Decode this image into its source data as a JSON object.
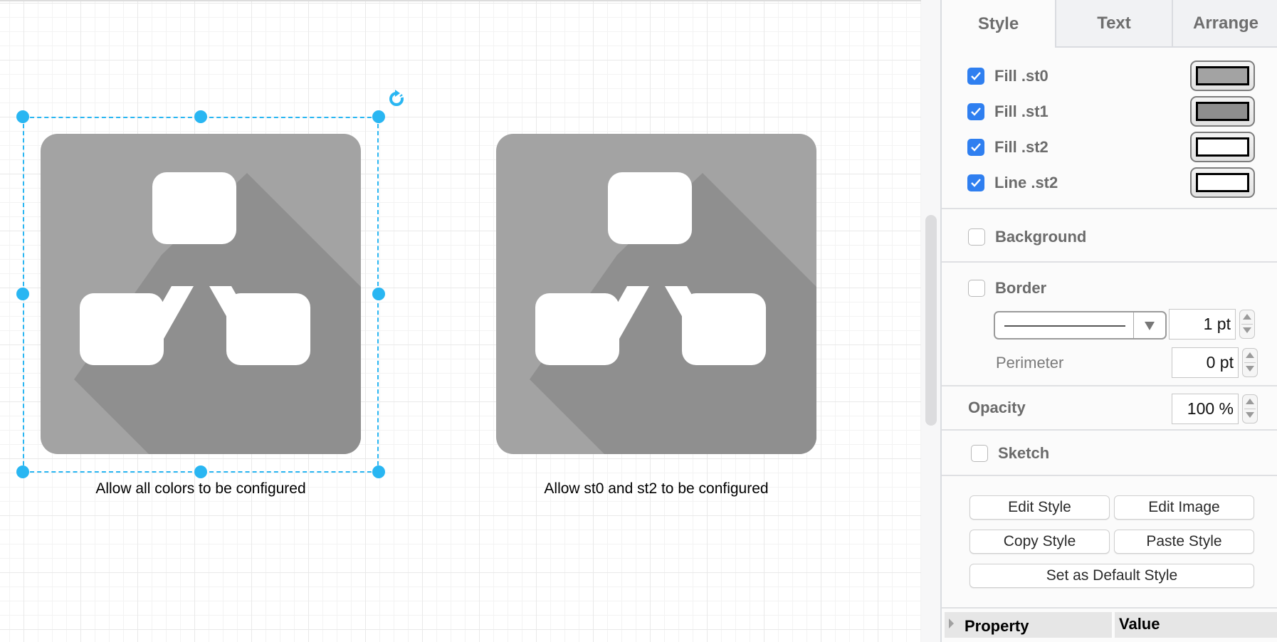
{
  "canvas": {
    "shapes": [
      {
        "name": "diagram-icon-all-colors",
        "label": "Allow all colors to be configured",
        "selected": true,
        "colors": {
          "st0": "#a3a3a3",
          "st1": "#8f8f8f",
          "st2": "#ffffff"
        }
      },
      {
        "name": "diagram-icon-st0-st2",
        "label": "Allow st0 and st2 to be configured",
        "selected": false,
        "colors": {
          "st0": "#a3a3a3",
          "st1": "#8f8f8f",
          "st2": "#ffffff"
        }
      }
    ],
    "selection_color": "#29b6f2",
    "rotate_icon": "rotate-icon"
  },
  "panel": {
    "tabs": [
      {
        "label": "Style",
        "active": true
      },
      {
        "label": "Text",
        "active": false
      },
      {
        "label": "Arrange",
        "active": false
      }
    ],
    "color_options": [
      {
        "label": "Fill .st0",
        "checked": true,
        "color": "#a3a3a3"
      },
      {
        "label": "Fill .st1",
        "checked": true,
        "color": "#8e8e8e"
      },
      {
        "label": "Fill .st2",
        "checked": true,
        "color": "#ffffff"
      },
      {
        "label": "Line .st2",
        "checked": true,
        "color": "#ffffff"
      }
    ],
    "background": {
      "label": "Background",
      "checked": false
    },
    "border": {
      "label": "Border",
      "checked": false,
      "line_style": "solid",
      "width_value": "1 pt",
      "perimeter_label": "Perimeter",
      "perimeter_value": "0 pt"
    },
    "opacity": {
      "label": "Opacity",
      "value": "100 %"
    },
    "sketch": {
      "label": "Sketch",
      "checked": false
    },
    "buttons": {
      "edit_style": "Edit Style",
      "edit_image": "Edit Image",
      "copy_style": "Copy Style",
      "paste_style": "Paste Style",
      "set_default": "Set as Default Style"
    },
    "property_table": {
      "col_property": "Property",
      "col_value": "Value"
    }
  }
}
